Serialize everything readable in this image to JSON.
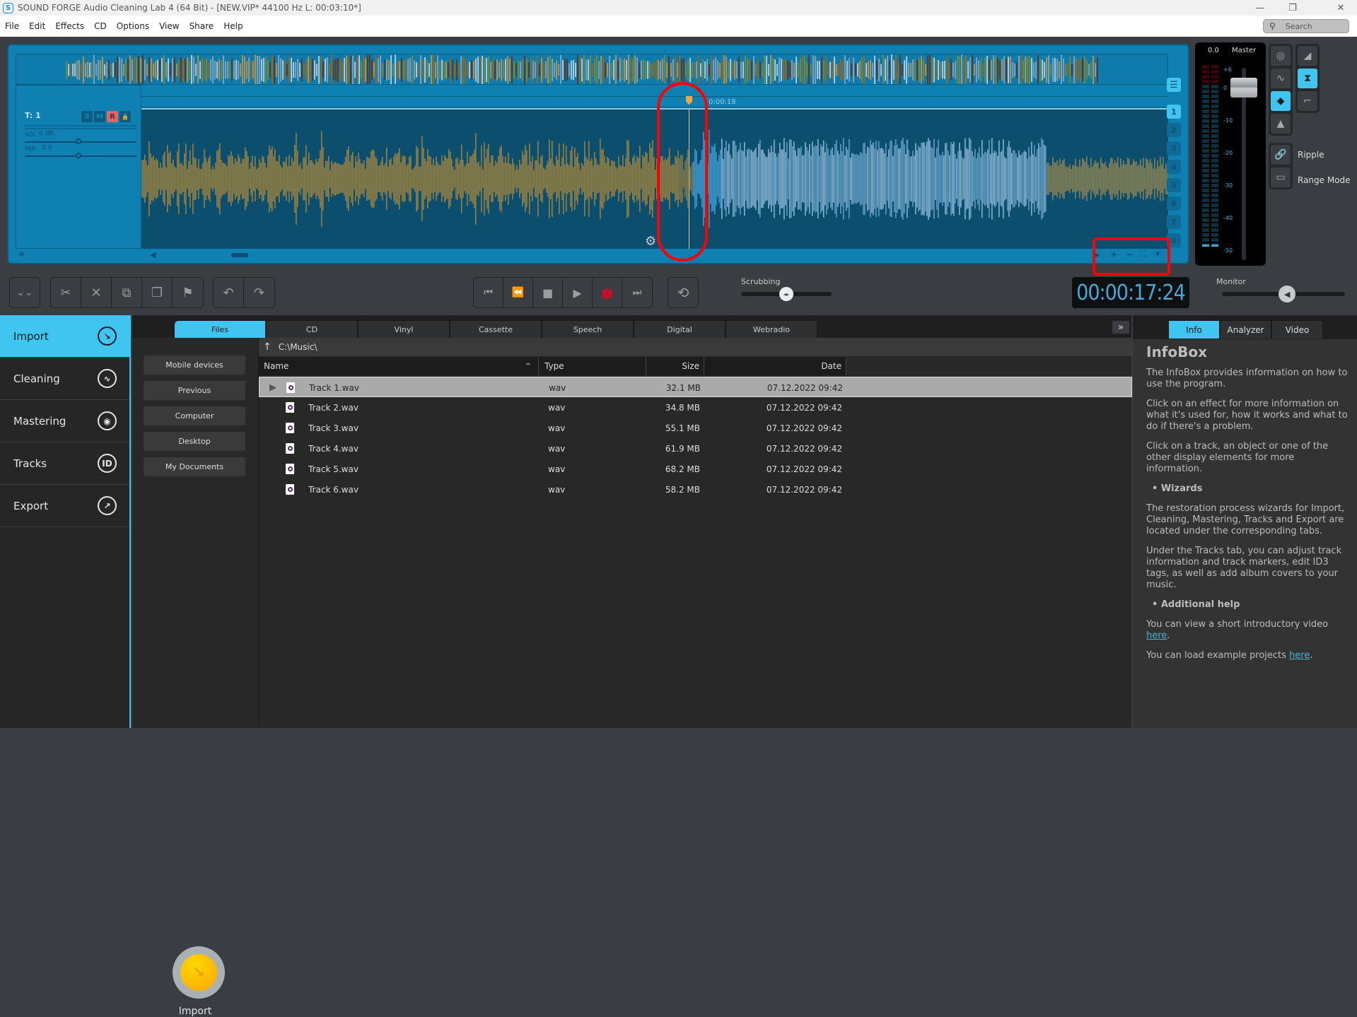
{
  "window": {
    "title": "SOUND FORGE Audio Cleaning Lab 4 (64 Bit) - [NEW.VIP*   44100 Hz L: 00:03:10*]",
    "app_icon": "S",
    "controls": {
      "minimize": "—",
      "maximize": "❐",
      "close": "✕"
    }
  },
  "menu": [
    "File",
    "Edit",
    "Effects",
    "CD",
    "Options",
    "View",
    "Share",
    "Help"
  ],
  "search": {
    "placeholder": "Search"
  },
  "editor": {
    "track": {
      "label": "T: 1",
      "solo": "S",
      "mute": "M",
      "record": "R",
      "lock": "🔒",
      "vol_label": "VOL",
      "vol_value": "0 dB",
      "pan_label": "PAN",
      "pan_value": "0.0"
    },
    "marker_time": "0:00:18",
    "track_numbers": [
      "1",
      "2",
      "3",
      "4",
      "5",
      "6",
      "7",
      "8"
    ],
    "active_track": "1",
    "zoom_controls": {
      "play": "▶",
      "plus": "+",
      "minus": "−",
      "fit": "⛶",
      "dropdown": "▾"
    },
    "scroll_left": "«",
    "scroll_prev": "◀"
  },
  "master": {
    "value": "0.0",
    "label": "Master",
    "scale": [
      "+6",
      "0",
      "-10",
      "-20",
      "-30",
      "-40",
      "-50"
    ]
  },
  "side_tools": {
    "ripple_label": "Ripple",
    "range_mode_label": "Range Mode"
  },
  "toolbar": {
    "collapse": "⌄⌄",
    "cut": "✂",
    "delete": "✕",
    "copy": "⧉",
    "paste": "❐",
    "marker": "⚑",
    "undo": "↶",
    "redo": "↷"
  },
  "transport": {
    "go_start": "⏮",
    "prev_marker": "⏪",
    "stop": "■",
    "play": "▶",
    "record": "●",
    "next_marker": "⏭",
    "loop": "⟲",
    "scrubbing_label": "Scrubbing",
    "scrubbing_value": 0.5,
    "counter": "00:00:17:24",
    "monitor_label": "Monitor",
    "monitor_value": 0.53
  },
  "nav": [
    {
      "label": "Import",
      "icon": "↘",
      "active": true
    },
    {
      "label": "Cleaning",
      "icon": "∿",
      "active": false
    },
    {
      "label": "Mastering",
      "icon": "◉",
      "active": false
    },
    {
      "label": "Tracks",
      "icon": "ID",
      "active": false
    },
    {
      "label": "Export",
      "icon": "↗",
      "active": false
    }
  ],
  "source_tabs": [
    "Files",
    "CD",
    "Vinyl",
    "Cassette",
    "Speech",
    "Digital",
    "Webradio"
  ],
  "active_source_tab": "Files",
  "places": [
    "Mobile devices",
    "Previous",
    "Computer",
    "Desktop",
    "My Documents"
  ],
  "import_button_label": "Import",
  "path": {
    "up": "↑",
    "value": "C:\\Music\\"
  },
  "file_columns": {
    "name": "Name",
    "type": "Type",
    "size": "Size",
    "date": "Date",
    "sort_indicator": "^"
  },
  "files": [
    {
      "name": "Track 1.wav",
      "type": "wav",
      "size": "32.1 MB",
      "date": "07.12.2022 09:42",
      "selected": true
    },
    {
      "name": "Track 2.wav",
      "type": "wav",
      "size": "34.8 MB",
      "date": "07.12.2022 09:42",
      "selected": false
    },
    {
      "name": "Track 3.wav",
      "type": "wav",
      "size": "55.1 MB",
      "date": "07.12.2022 09:42",
      "selected": false
    },
    {
      "name": "Track 4.wav",
      "type": "wav",
      "size": "61.9 MB",
      "date": "07.12.2022 09:42",
      "selected": false
    },
    {
      "name": "Track 5.wav",
      "type": "wav",
      "size": "68.2 MB",
      "date": "07.12.2022 09:42",
      "selected": false
    },
    {
      "name": "Track 6.wav",
      "type": "wav",
      "size": "58.2 MB",
      "date": "07.12.2022 09:42",
      "selected": false
    }
  ],
  "expand_button": "»",
  "info_tabs": [
    "Info",
    "Analyzer",
    "Video"
  ],
  "active_info_tab": "Info",
  "infobox": {
    "title": "InfoBox",
    "p1": "The InfoBox provides information on how to use the program.",
    "p2": "Click on an effect for more information on what it's used for, how it works and what to do if there's a problem.",
    "p3": "Click on a track, an object or one of the other display elements for more information.",
    "bullet1": "• Wizards",
    "p4": "The restoration process wizards for Import, Cleaning, Mastering, Tracks and Export are located under the corresponding tabs.",
    "p5": "Under the Tracks tab, you can adjust track information and track markers, edit ID3 tags, as well as add album covers to your music.",
    "bullet2": "• Additional help",
    "p6_pre": "You can view a short introductory video ",
    "p6_link": "here",
    "p6_post": ".",
    "p7_pre": "You can load example projects ",
    "p7_link": "here",
    "p7_post": "."
  },
  "colors": {
    "accent": "#3fc5f0",
    "editor_bg": "#0e80b2",
    "wave_bg": "#0b4e6e",
    "record": "#c0102c",
    "annotation": "#ff0000"
  }
}
